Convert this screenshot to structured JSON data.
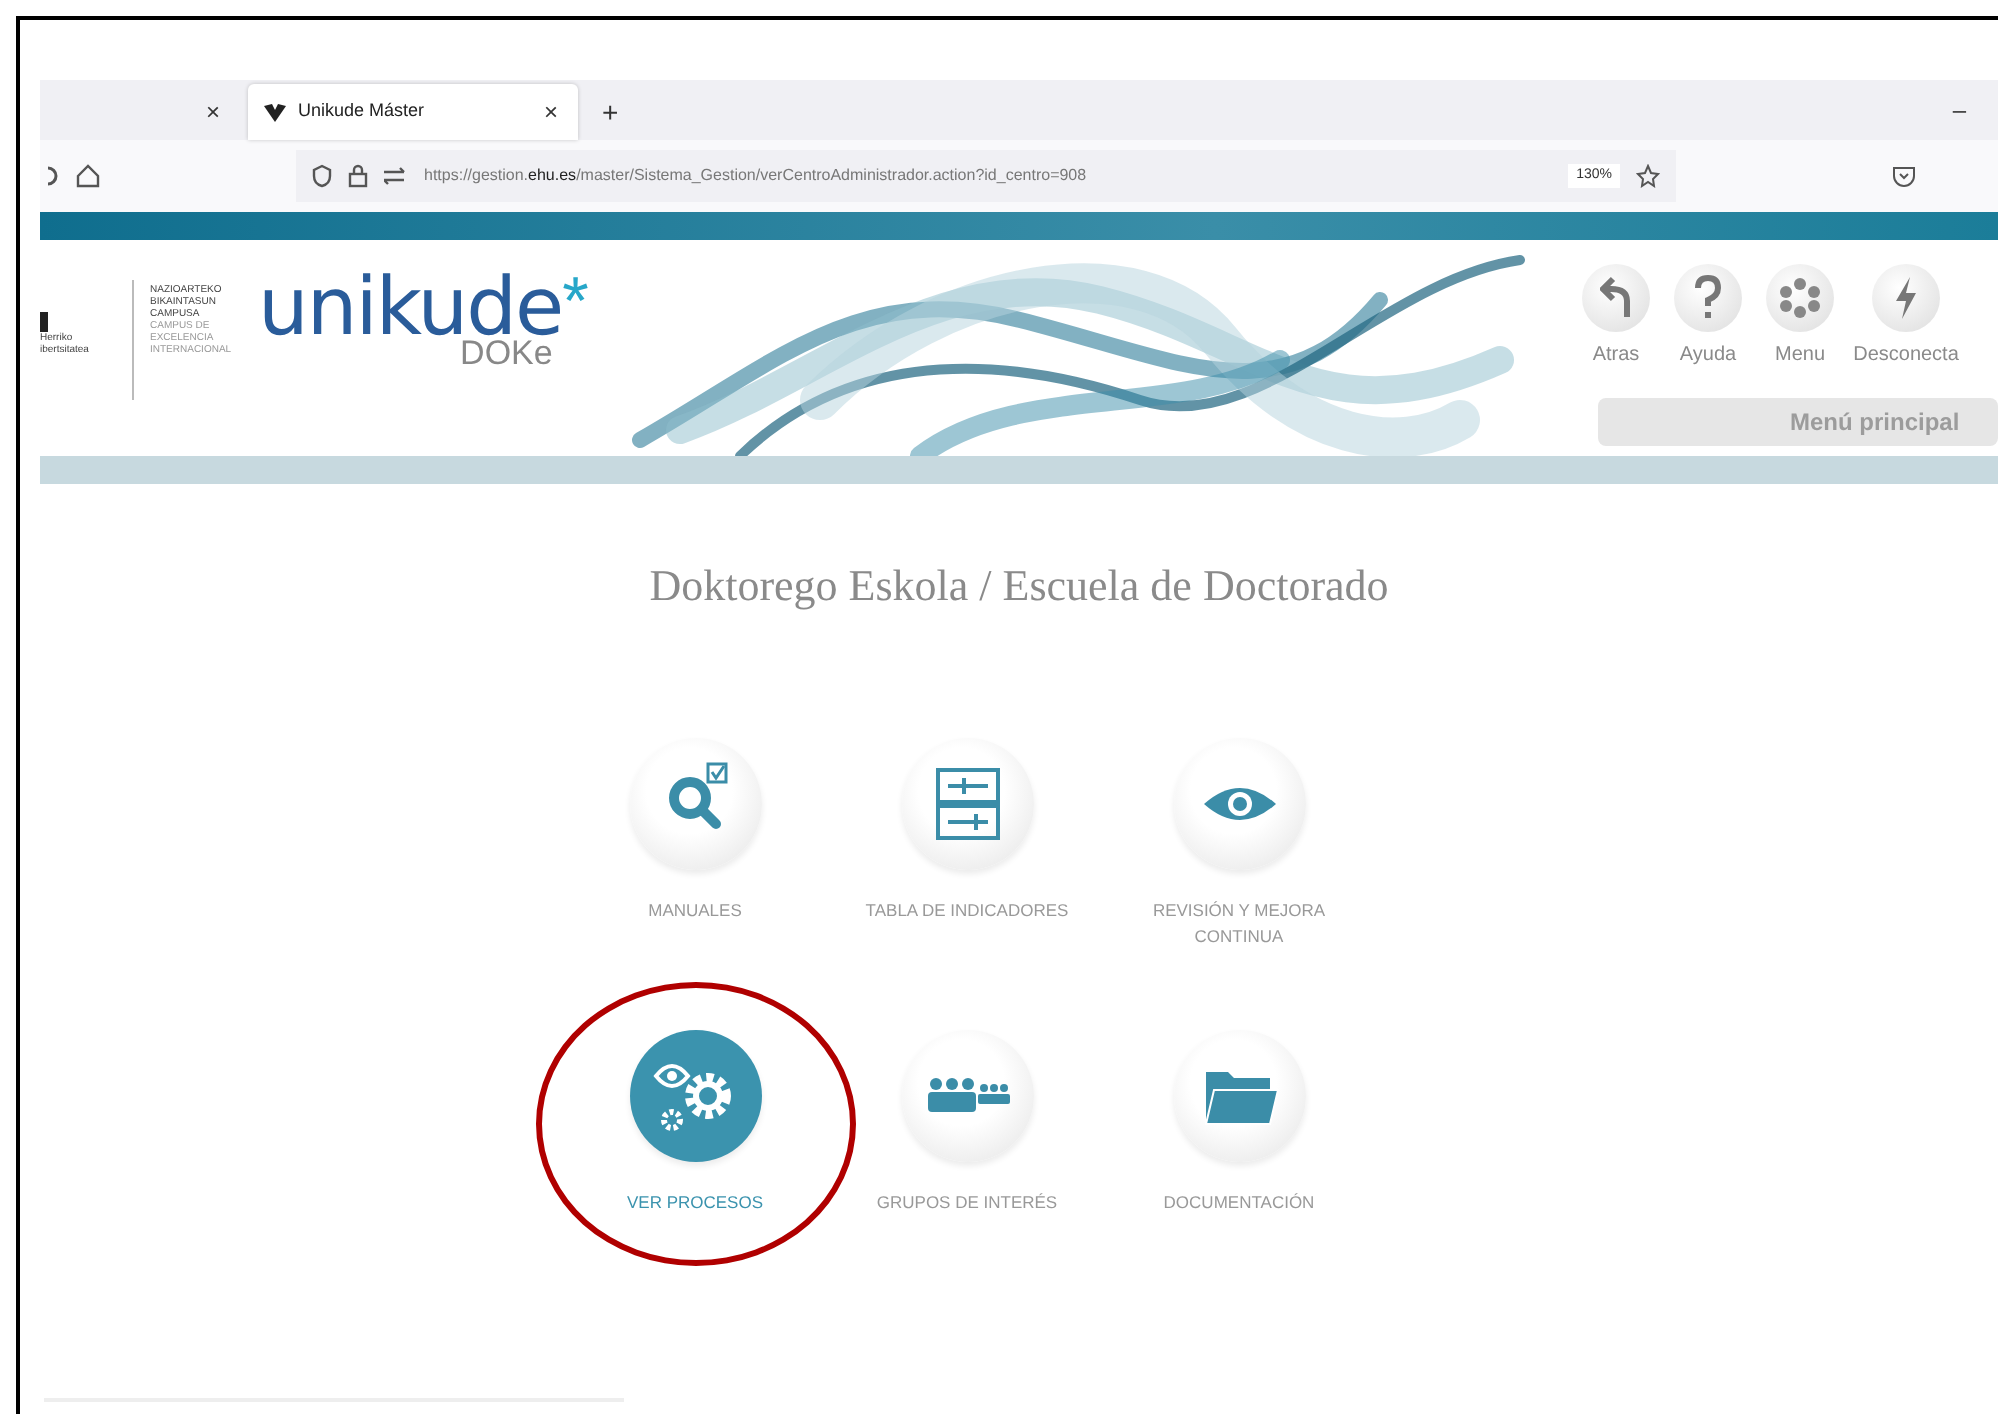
{
  "browser": {
    "tabs": [
      {
        "close": "×",
        "selected": false
      },
      {
        "title": "Unikude Máster",
        "close": "×",
        "selected": true
      }
    ],
    "new_tab": "+",
    "window_control": "–",
    "address": "https://gestion.**ehu.es**/master/Sistema_Gestion/verCentroAdministrador.action?id_centro=908",
    "zoom": "130%"
  },
  "header": {
    "university_text": [
      "Herriko",
      "ibertsitatea"
    ],
    "campus_text": [
      "NAZIOARTEKO",
      "BIKAINTASUN",
      "CAMPUSA"
    ],
    "campus_text_es": [
      "CAMPUS DE",
      "EXCELENCIA",
      "INTERNACIONAL"
    ],
    "logo": {
      "name": "unikude",
      "star": "*",
      "sub": "DOKe"
    },
    "actions": [
      {
        "kind": "back",
        "label": "Atras"
      },
      {
        "kind": "help",
        "label": "Ayuda"
      },
      {
        "kind": "menu",
        "label": "Menu"
      },
      {
        "kind": "logout",
        "label": "Desconecta"
      }
    ],
    "main_menu": "Menú principal"
  },
  "title": "Doktorego Eskola / Escuela de Doctorado",
  "tiles": [
    [
      {
        "kind": "manuals",
        "label": "MANUALES",
        "selected": false,
        "circled": false
      },
      {
        "kind": "indicators",
        "label": "TABLA DE INDICADORES",
        "selected": false,
        "circled": false
      },
      {
        "kind": "review",
        "label": "REVISIÓN Y MEJORA CONTINUA",
        "selected": false,
        "circled": false
      }
    ],
    [
      {
        "kind": "processes",
        "label": "VER PROCESOS",
        "selected": true,
        "circled": true
      },
      {
        "kind": "groups",
        "label": "GRUPOS DE INTERÉS",
        "selected": false,
        "circled": false
      },
      {
        "kind": "docs",
        "label": "DOCUMENTACIÓN",
        "selected": false,
        "circled": false
      }
    ]
  ]
}
